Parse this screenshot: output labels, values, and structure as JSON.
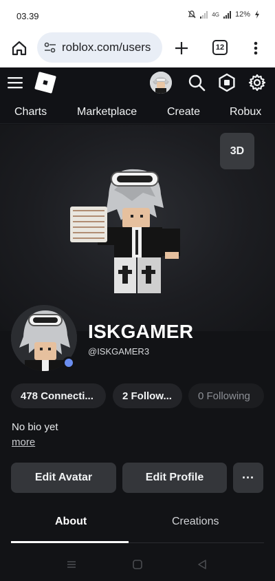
{
  "status_bar": {
    "time": "03.39",
    "network": "4G",
    "battery": "12%"
  },
  "browser": {
    "url": "roblox.com/users",
    "tab_count": "12"
  },
  "nav": {
    "items": [
      "Charts",
      "Marketplace",
      "Create",
      "Robux"
    ]
  },
  "avatar_stage": {
    "view_toggle": "3D"
  },
  "profile": {
    "display_name": "ISKGAMER",
    "username": "@ISKGAMER3",
    "online_status_color": "#6b8ef0",
    "connections": "478 Connecti...",
    "followers": "2 Follow...",
    "following": "0 Following",
    "bio": "No bio yet",
    "more_link": "more"
  },
  "actions": {
    "edit_avatar": "Edit Avatar",
    "edit_profile": "Edit Profile",
    "more_options": "···"
  },
  "tabs": {
    "about": "About",
    "creations": "Creations",
    "active": "About"
  },
  "icons": {
    "home": "home-icon",
    "site_settings": "tune-icon",
    "new_tab": "plus-icon",
    "tabs": "tab-switcher-icon",
    "browser_menu": "kebab-menu-icon",
    "menu": "hamburger-icon",
    "logo": "roblox-logo",
    "search": "search-icon",
    "robux": "robux-icon",
    "settings": "gear-icon"
  },
  "colors": {
    "background": "#121316",
    "surface": "#34363a",
    "accent_online": "#6b8ef0"
  }
}
